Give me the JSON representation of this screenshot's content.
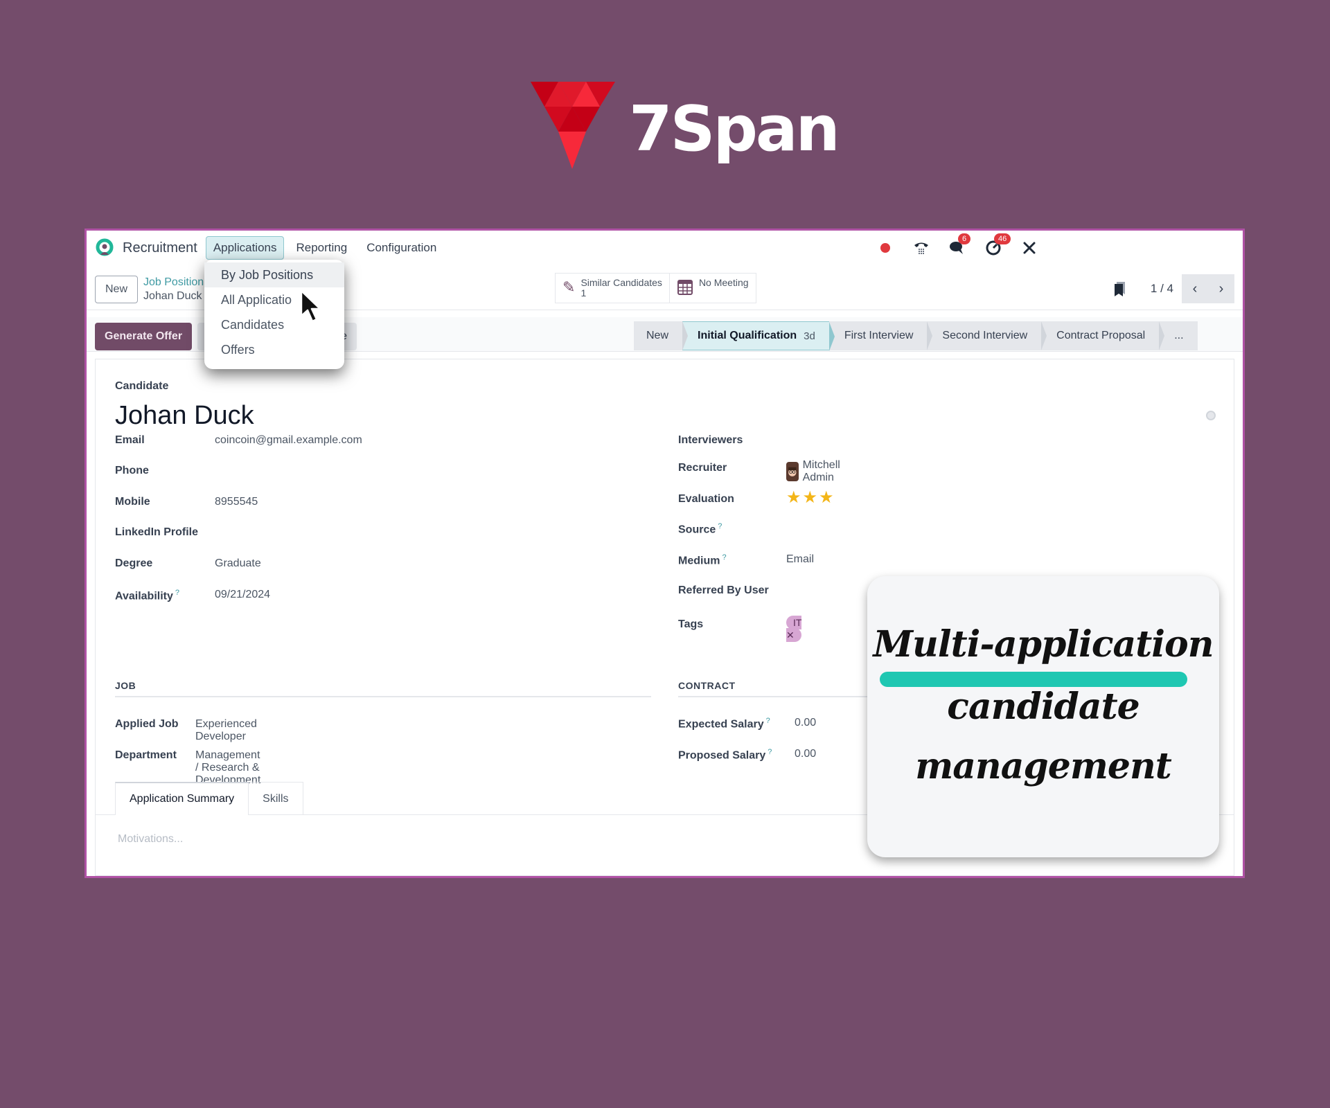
{
  "brand": {
    "name": "7Span",
    "colors": {
      "primary": "#e0192b",
      "dark": "#c40016",
      "light": "#f7293a"
    }
  },
  "navbar": {
    "app_icon": "recruitment-icon",
    "app_name": "Recruitment",
    "menu": [
      {
        "label": "Applications",
        "active": true
      },
      {
        "label": "Reporting",
        "active": false
      },
      {
        "label": "Configuration",
        "active": false
      }
    ],
    "systray": [
      {
        "icon": "recording-dot-icon"
      },
      {
        "icon": "phone-icon"
      },
      {
        "icon": "chat-icon",
        "badge": "6"
      },
      {
        "icon": "activity-clock-icon",
        "badge": "46"
      },
      {
        "icon": "tools-icon"
      }
    ]
  },
  "applications_menu": {
    "items": [
      {
        "label": "By Job Positions",
        "hover": true
      },
      {
        "label": "All Applications",
        "display": "All Applicatio"
      },
      {
        "label": "Candidates"
      },
      {
        "label": "Offers"
      }
    ]
  },
  "control_panel": {
    "new_label": "New",
    "breadcrumb": {
      "parent": "Job Position",
      "current": "Johan Duck"
    },
    "smart_buttons": [
      {
        "icon": "pencil-icon",
        "label": "Similar Candidates",
        "value": "1"
      },
      {
        "icon": "calendar-icon",
        "label": "No Meeting",
        "value": ""
      }
    ],
    "pager": {
      "value": "1 / 4",
      "prev_icon": "chevron-left-icon",
      "next_icon": "chevron-right-icon",
      "bookmark_icon": "bookmark-icon"
    }
  },
  "actions": {
    "primary_label": "Generate Offer",
    "secondary_label_visible": "e"
  },
  "statusbar": {
    "stages": [
      {
        "label": "New",
        "current": false
      },
      {
        "label": "Initial Qualification",
        "duration": "3d",
        "current": true
      },
      {
        "label": "First Interview",
        "current": false
      },
      {
        "label": "Second Interview",
        "current": false
      },
      {
        "label": "Contract Proposal",
        "current": false
      },
      {
        "label": "...",
        "current": false
      }
    ]
  },
  "form": {
    "candidate_label": "Candidate",
    "candidate_name": "Johan Duck",
    "left_fields": [
      {
        "label": "Email",
        "value": "coincoin@gmail.example.com"
      },
      {
        "label": "Phone",
        "value": ""
      },
      {
        "label": "Mobile",
        "value": "8955545"
      },
      {
        "label": "LinkedIn Profile",
        "value": ""
      },
      {
        "label": "Degree",
        "value": "Graduate"
      },
      {
        "label": "Availability",
        "value": "09/21/2024",
        "help": "?"
      }
    ],
    "right_fields": {
      "interviewers": {
        "label": "Interviewers",
        "value": ""
      },
      "recruiter": {
        "label": "Recruiter",
        "value": "Mitchell Admin"
      },
      "evaluation": {
        "label": "Evaluation",
        "stars": 3,
        "max_stars": 3,
        "value": "★★★"
      },
      "source": {
        "label": "Source",
        "value": "",
        "help": "?"
      },
      "medium": {
        "label": "Medium",
        "value": "Email",
        "help": "?"
      },
      "referred": {
        "label": "Referred By User",
        "value": ""
      },
      "tags": {
        "label": "Tags",
        "items": [
          "IT"
        ],
        "remove_glyph": "✕"
      }
    },
    "job_section": {
      "title": "JOB",
      "fields": [
        {
          "label": "Applied Job",
          "value": "Experienced Developer"
        },
        {
          "label": "Department",
          "value": "Management / Research & Development"
        }
      ]
    },
    "contract_section": {
      "title": "CONTRACT",
      "fields": [
        {
          "label": "Expected Salary",
          "value": "0.00",
          "help": "?"
        },
        {
          "label": "Proposed Salary",
          "value": "0.00",
          "help": "?"
        }
      ]
    },
    "tabs": [
      {
        "label": "Application Summary",
        "active": true
      },
      {
        "label": "Skills",
        "active": false
      }
    ],
    "summary_placeholder": "Motivations..."
  },
  "promo": {
    "lines": [
      "Multi-application",
      "candidate",
      "management"
    ],
    "highlight_color": "#1fc7b2"
  },
  "colors": {
    "background": "#744c6b",
    "odoo_primary": "#714b67",
    "accent_teal": "#3f9aa3",
    "badge_red": "#e0393e",
    "star": "#f3b518",
    "tag_bg": "#d7a6d3"
  }
}
